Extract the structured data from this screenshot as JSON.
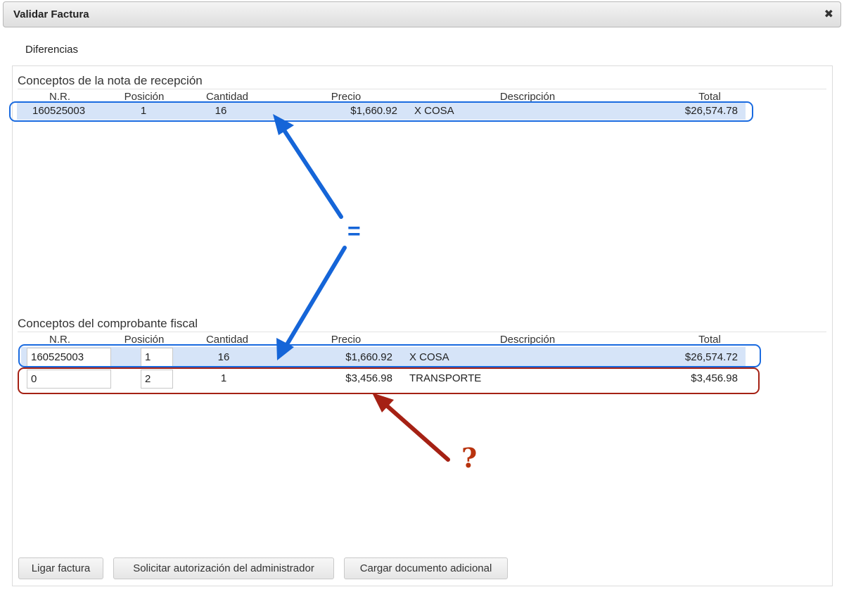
{
  "dialog": {
    "title": "Validar Factura",
    "close_icon": "close-icon",
    "tab_label": "Diferencias"
  },
  "columns": [
    "N.R.",
    "Posición",
    "Cantidad",
    "Precio",
    "Descripción",
    "Total"
  ],
  "recepcion": {
    "title": "Conceptos de la nota de recepción",
    "rows": [
      {
        "nr": "160525003",
        "posicion": "1",
        "cantidad": "16",
        "precio": "$1,660.92",
        "descripcion": "X COSA",
        "total": "$26,574.78"
      }
    ]
  },
  "comprobante": {
    "title": "Conceptos del comprobante fiscal",
    "rows": [
      {
        "nr": "160525003",
        "posicion": "1",
        "cantidad": "16",
        "precio": "$1,660.92",
        "descripcion": "X COSA",
        "total": "$26,574.72"
      },
      {
        "nr": "0",
        "posicion": "2",
        "cantidad": "1",
        "precio": "$3,456.98",
        "descripcion": "TRANSPORTE",
        "total": "$3,456.98"
      }
    ]
  },
  "annotations": {
    "equals": "=",
    "question": "?",
    "blue_color": "#1a6be0",
    "red_color": "#a52114"
  },
  "buttons": {
    "link": "Ligar factura",
    "authorize": "Solicitar autorización del administrador",
    "upload": "Cargar documento adicional"
  }
}
